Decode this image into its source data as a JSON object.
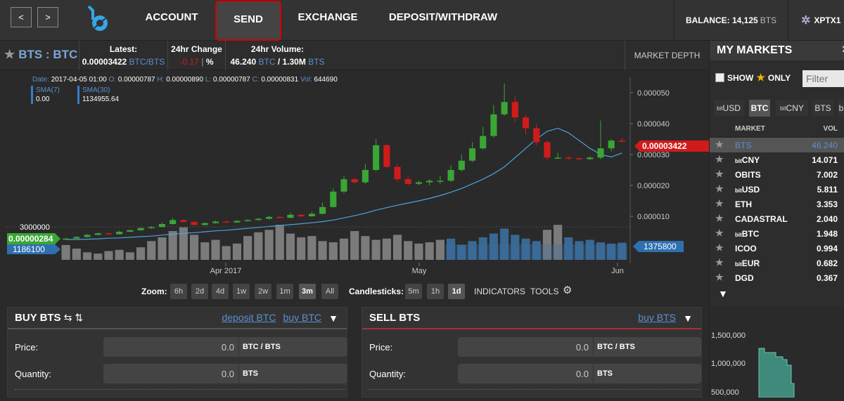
{
  "nav": {
    "back": "<",
    "forward": ">",
    "tabs": [
      "ACCOUNT",
      "SEND",
      "EXCHANGE",
      "DEPOSIT/WITHDRAW"
    ]
  },
  "balance": {
    "label": "BALANCE:",
    "amount": "14,125",
    "unit": "BTS"
  },
  "account": {
    "name": "XPTX1"
  },
  "ticker": {
    "pair": "BTS : BTC",
    "latest_label": "Latest:",
    "latest_value": "0.00003422",
    "latest_unit": "BTC/BTS",
    "change_label": "24hr Change",
    "change_value": "-0.17",
    "change_unit": "%",
    "volume_label": "24hr Volume:",
    "volume_value": "46.240",
    "volume_unit1": "BTC",
    "volume_sep": "/ 1.30M",
    "volume_unit2": "BTS",
    "market_depth": "MARKET DEPTH"
  },
  "ohlc": {
    "date_k": "Date:",
    "date": "2017-04-05 01:00",
    "o_k": "O:",
    "o": "0.00000787",
    "h_k": "H:",
    "h": "0.00000890",
    "l_k": "L:",
    "l": "0.00000787",
    "c_k": "C:",
    "c": "0.00000831",
    "vol_k": "Vol:",
    "vol": "644690"
  },
  "sma": [
    {
      "name": "SMA(7)",
      "value": "0.00"
    },
    {
      "name": "SMA(30)",
      "value": "1134955.64"
    }
  ],
  "chart_data": {
    "type": "candlestick",
    "price_ticks": [
      "0.000050",
      "0.000040",
      "0.000030",
      "0.000020",
      "0.000010"
    ],
    "price_range": [
      0,
      5.5e-05
    ],
    "x_labels": [
      "Apr 2017",
      "May",
      "Jun"
    ],
    "last_price_label": "0.00003422",
    "left_price_label": "0.00000284",
    "volume_axis_label": "3000000",
    "left_volume_label": "1186100",
    "last_volume_label": "1375800",
    "candles": [
      {
        "o": 2.5e-06,
        "c": 2.8e-06,
        "h": 3e-06,
        "l": 2.3e-06
      },
      {
        "o": 2.8e-06,
        "c": 3.3e-06,
        "h": 3.6e-06,
        "l": 2.7e-06
      },
      {
        "o": 3.3e-06,
        "c": 4e-06,
        "h": 4.3e-06,
        "l": 3.1e-06
      },
      {
        "o": 4e-06,
        "c": 4.5e-06,
        "h": 4.7e-06,
        "l": 3.8e-06
      },
      {
        "o": 4.5e-06,
        "c": 4.2e-06,
        "h": 4.8e-06,
        "l": 4e-06
      },
      {
        "o": 4.2e-06,
        "c": 5e-06,
        "h": 5.3e-06,
        "l": 4.1e-06
      },
      {
        "o": 5e-06,
        "c": 5.5e-06,
        "h": 5.7e-06,
        "l": 4.9e-06
      },
      {
        "o": 5.5e-06,
        "c": 6.2e-06,
        "h": 6.4e-06,
        "l": 5.3e-06
      },
      {
        "o": 6.2e-06,
        "c": 6.5e-06,
        "h": 6.8e-06,
        "l": 6e-06
      },
      {
        "o": 6.5e-06,
        "c": 7.5e-06,
        "h": 8e-06,
        "l": 6.4e-06
      },
      {
        "o": 7.5e-06,
        "c": 8.8e-06,
        "h": 9.5e-06,
        "l": 7.3e-06
      },
      {
        "o": 8.8e-06,
        "c": 8.2e-06,
        "h": 9e-06,
        "l": 8e-06
      },
      {
        "o": 8.2e-06,
        "c": 7.2e-06,
        "h": 8.5e-06,
        "l": 7e-06
      },
      {
        "o": 7.2e-06,
        "c": 7.8e-06,
        "h": 8e-06,
        "l": 7e-06
      },
      {
        "o": 7.8e-06,
        "c": 8.3e-06,
        "h": 8.6e-06,
        "l": 7.6e-06
      },
      {
        "o": 8.3e-06,
        "c": 8e-06,
        "h": 8.6e-06,
        "l": 7.8e-06
      },
      {
        "o": 8e-06,
        "c": 8.5e-06,
        "h": 8.8e-06,
        "l": 7.9e-06
      },
      {
        "o": 8.5e-06,
        "c": 8.8e-06,
        "h": 9e-06,
        "l": 8.3e-06
      },
      {
        "o": 8.8e-06,
        "c": 9.2e-06,
        "h": 9.5e-06,
        "l": 8.6e-06
      },
      {
        "o": 9.2e-06,
        "c": 9.8e-06,
        "h": 1.02e-05,
        "l": 9e-06
      },
      {
        "o": 9.8e-06,
        "c": 9.5e-06,
        "h": 1e-05,
        "l": 9.3e-06
      },
      {
        "o": 9.5e-06,
        "c": 1.05e-05,
        "h": 1.12e-05,
        "l": 9.4e-06
      },
      {
        "o": 1.05e-05,
        "c": 1e-05,
        "h": 1.08e-05,
        "l": 9.7e-06
      },
      {
        "o": 1e-05,
        "c": 1.08e-05,
        "h": 1.15e-05,
        "l": 9.9e-06
      },
      {
        "o": 1.08e-05,
        "c": 1.3e-05,
        "h": 1.45e-05,
        "l": 1.07e-05
      },
      {
        "o": 1.3e-05,
        "c": 1.8e-05,
        "h": 1.9e-05,
        "l": 1.28e-05
      },
      {
        "o": 1.8e-05,
        "c": 2.2e-05,
        "h": 2.3e-05,
        "l": 1.75e-05
      },
      {
        "o": 2.2e-05,
        "c": 2.1e-05,
        "h": 2.25e-05,
        "l": 2.05e-05
      },
      {
        "o": 2.1e-05,
        "c": 2.5e-05,
        "h": 2.7e-05,
        "l": 2.05e-05
      },
      {
        "o": 2.5e-05,
        "c": 3.3e-05,
        "h": 3.5e-05,
        "l": 2.45e-05
      },
      {
        "o": 3.3e-05,
        "c": 2.6e-05,
        "h": 3.35e-05,
        "l": 2.55e-05
      },
      {
        "o": 2.6e-05,
        "c": 2.2e-05,
        "h": 2.7e-05,
        "l": 2.1e-05
      },
      {
        "o": 2.2e-05,
        "c": 2.05e-05,
        "h": 2.3e-05,
        "l": 2e-05
      },
      {
        "o": 2.05e-05,
        "c": 2.1e-05,
        "h": 2.15e-05,
        "l": 2e-05
      },
      {
        "o": 2.1e-05,
        "c": 2.15e-05,
        "h": 2.2e-05,
        "l": 2e-05
      },
      {
        "o": 2.15e-05,
        "c": 2.15e-05,
        "h": 2.3e-05,
        "l": 2.05e-05
      },
      {
        "o": 2.15e-05,
        "c": 2.5e-05,
        "h": 2.65e-05,
        "l": 2.12e-05
      },
      {
        "o": 2.5e-05,
        "c": 2.8e-05,
        "h": 3e-05,
        "l": 2.45e-05
      },
      {
        "o": 2.8e-05,
        "c": 3.2e-05,
        "h": 3.4e-05,
        "l": 2.75e-05
      },
      {
        "o": 3.2e-05,
        "c": 3.6e-05,
        "h": 3.9e-05,
        "l": 3.15e-05
      },
      {
        "o": 3.6e-05,
        "c": 4.3e-05,
        "h": 4.6e-05,
        "l": 3.55e-05
      },
      {
        "o": 4.3e-05,
        "c": 4.7e-05,
        "h": 5.3e-05,
        "l": 4.25e-05
      },
      {
        "o": 4.7e-05,
        "c": 4.2e-05,
        "h": 4.9e-05,
        "l": 4.05e-05
      },
      {
        "o": 4.2e-05,
        "c": 3.85e-05,
        "h": 4.3e-05,
        "l": 3.65e-05
      },
      {
        "o": 3.85e-05,
        "c": 3.4e-05,
        "h": 4e-05,
        "l": 3.3e-05
      },
      {
        "o": 3.4e-05,
        "c": 2.9e-05,
        "h": 3.45e-05,
        "l": 2.8e-05
      },
      {
        "o": 2.9e-05,
        "c": 2.9e-05,
        "h": 3.05e-05,
        "l": 2.85e-05
      },
      {
        "o": 2.9e-05,
        "c": 2.88e-05,
        "h": 2.95e-05,
        "l": 2.82e-05
      },
      {
        "o": 2.88e-05,
        "c": 2.85e-05,
        "h": 2.9e-05,
        "l": 2.8e-05
      },
      {
        "o": 2.85e-05,
        "c": 2.9e-05,
        "h": 2.95e-05,
        "l": 2.83e-05
      },
      {
        "o": 2.9e-05,
        "c": 3.2e-05,
        "h": 4.1e-05,
        "l": 2.85e-05
      },
      {
        "o": 3.2e-05,
        "c": 3.45e-05,
        "h": 3.5e-05,
        "l": 3.1e-05
      },
      {
        "o": 3.45e-05,
        "c": 3.422e-05,
        "h": 3.55e-05,
        "l": 3.4e-05
      }
    ],
    "sma30": [
      2.5e-06,
      2.5e-06,
      2.6e-06,
      2.7e-06,
      2.9e-06,
      3e-06,
      3.2e-06,
      3.4e-06,
      3.6e-06,
      3.9e-06,
      4.2e-06,
      4.5e-06,
      4.7e-06,
      5e-06,
      5.3e-06,
      5.5e-06,
      5.8e-06,
      6.1e-06,
      6.4e-06,
      6.7e-06,
      7e-06,
      7.3e-06,
      7.6e-06,
      7.9e-06,
      8.3e-06,
      8.8e-06,
      9.5e-06,
      1.02e-05,
      1.1e-05,
      1.2e-05,
      1.28e-05,
      1.36e-05,
      1.43e-05,
      1.5e-05,
      1.58e-05,
      1.67e-05,
      1.78e-05,
      1.9e-05,
      2.05e-05,
      2.2e-05,
      2.38e-05,
      2.6e-05,
      2.9e-05,
      3.2e-05,
      3.5e-05,
      3.75e-05,
      3.85e-05,
      3.7e-05,
      3.45e-05,
      3.2e-05,
      3e-05,
      2.92e-05,
      3.05e-05
    ],
    "volume": [
      1186100,
      900000,
      600000,
      500000,
      700000,
      800000,
      600000,
      1000000,
      1500000,
      1800000,
      2300000,
      2600000,
      2000000,
      1400000,
      1600000,
      1100000,
      1300000,
      1900000,
      2200000,
      2400000,
      2800000,
      2100000,
      1800000,
      1900000,
      1500000,
      1400000,
      1700000,
      2300000,
      1900000,
      1600000,
      1700000,
      2000000,
      1500000,
      1300000,
      1400000,
      1600000,
      1700000,
      1200000,
      1500000,
      1800000,
      2100000,
      2500000,
      2000000,
      1700000,
      1500000,
      2400000,
      2800000,
      1800000,
      1500000,
      1600000,
      1400000,
      1300000,
      1375800
    ]
  },
  "zoom": {
    "label": "Zoom:",
    "options": [
      "6h",
      "2d",
      "4d",
      "1w",
      "2w",
      "1m",
      "3m",
      "All"
    ],
    "active": "3m"
  },
  "candles": {
    "label": "Candlesticks:",
    "options": [
      "5m",
      "1h",
      "1d"
    ],
    "active": "1d"
  },
  "tools": {
    "indicators": "INDICATORS",
    "tools": "TOOLS"
  },
  "buy": {
    "title": "BUY BTS",
    "icons": "⇆ ⇅",
    "link1": "deposit BTC",
    "link2": "buy BTC",
    "price_label": "Price:",
    "price_value": "0.0",
    "price_unit": "BTC / BTS",
    "qty_label": "Quantity:",
    "qty_value": "0.0",
    "qty_unit": "BTS"
  },
  "sell": {
    "title": "SELL BTS",
    "link1": "buy BTS",
    "price_label": "Price:",
    "price_value": "0.0",
    "price_unit": "BTC / BTS",
    "qty_label": "Quantity:",
    "qty_value": "0.0",
    "qty_unit": "BTS"
  },
  "sidebar": {
    "title": "MY MARKETS",
    "show": "SHOW",
    "only": "ONLY",
    "filter_placeholder": "Filter",
    "tabs": [
      {
        "pre": "bit",
        "name": "USD"
      },
      {
        "pre": "",
        "name": "BTC"
      },
      {
        "pre": "bit",
        "name": "CNY"
      },
      {
        "pre": "",
        "name": "BTS"
      },
      {
        "pre": "",
        "name": "b"
      }
    ],
    "col_market": "MARKET",
    "col_vol": "VOL",
    "markets": [
      {
        "pre": "",
        "name": "BTS",
        "vol": "46.240"
      },
      {
        "pre": "bit",
        "name": "CNY",
        "vol": "14.071"
      },
      {
        "pre": "",
        "name": "OBITS",
        "vol": "7.002"
      },
      {
        "pre": "bit",
        "name": "USD",
        "vol": "5.811"
      },
      {
        "pre": "",
        "name": "ETH",
        "vol": "3.353"
      },
      {
        "pre": "",
        "name": "CADASTRAL",
        "vol": "2.040"
      },
      {
        "pre": "bit",
        "name": "BTC",
        "vol": "1.948"
      },
      {
        "pre": "",
        "name": "ICOO",
        "vol": "0.994"
      },
      {
        "pre": "bit",
        "name": "EUR",
        "vol": "0.682"
      },
      {
        "pre": "",
        "name": "DGD",
        "vol": "0.367"
      }
    ],
    "depth_ticks": [
      "1,500,000",
      "1,000,000",
      "500,000"
    ]
  },
  "colors": {
    "up": "#3aa635",
    "down": "#d11b1b",
    "accent": "#5b8fd0",
    "volume": "#3b6fa0"
  }
}
